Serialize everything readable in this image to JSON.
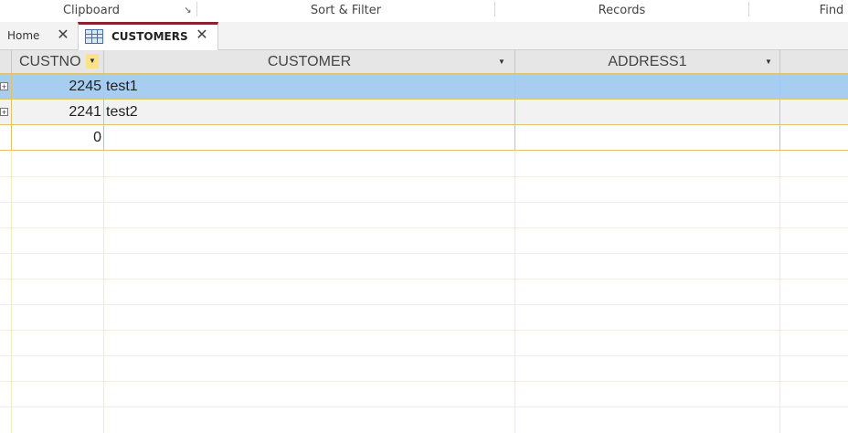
{
  "ribbon": {
    "groups": [
      "Clipboard",
      "Sort & Filter",
      "Records",
      "Find"
    ],
    "launcher_icon": "dialog-launcher-icon"
  },
  "tabs": {
    "home_label": "Home",
    "customers_label": "CUSTOMERS",
    "close_glyph": "✕"
  },
  "table": {
    "columns": [
      {
        "label": "CUSTNO",
        "sort_active": true
      },
      {
        "label": "CUSTOMER",
        "sort_active": false
      },
      {
        "label": "ADDRESS1",
        "sort_active": false
      }
    ],
    "rows": [
      {
        "custno": "2245",
        "customer": "test1",
        "address1": "",
        "selected": true,
        "expandable": true
      },
      {
        "custno": "2241",
        "customer": "test2",
        "address1": "",
        "selected": false,
        "expandable": true
      },
      {
        "custno": "0",
        "customer": "",
        "address1": "",
        "selected": false,
        "expandable": false
      }
    ]
  },
  "colors": {
    "accent_tab": "#8b2232",
    "selected_row": "#a7cdf0",
    "grid_line": "#e3c36a"
  }
}
